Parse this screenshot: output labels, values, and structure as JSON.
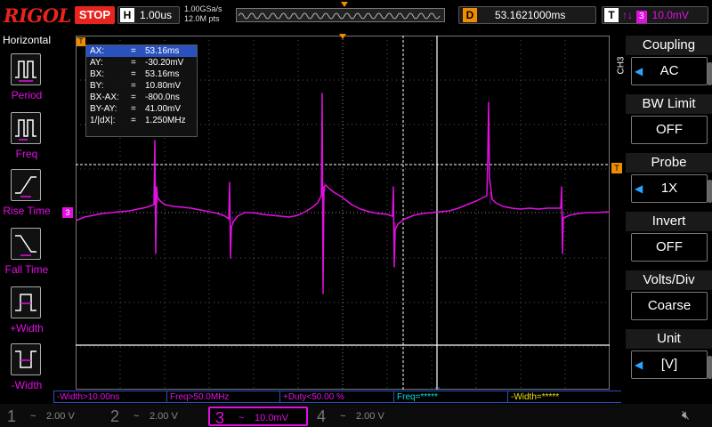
{
  "brand": "RIGOL",
  "run_state": "STOP",
  "timebase": {
    "label": "H",
    "value": "1.00us"
  },
  "acquisition": {
    "sample_rate": "1.00GSa/s",
    "points": "12.0M pts"
  },
  "delay": {
    "label": "D",
    "value": "53.1621000ms"
  },
  "trigger": {
    "label": "T",
    "edge": "↑↓",
    "source": "3",
    "level": "10.0mV"
  },
  "left_menu": {
    "title": "Horizontal",
    "items": [
      {
        "label": "Period",
        "icon": "period-icon"
      },
      {
        "label": "Freq",
        "icon": "freq-icon"
      },
      {
        "label": "Rise Time",
        "icon": "rise-time-icon"
      },
      {
        "label": "Fall Time",
        "icon": "fall-time-icon"
      },
      {
        "label": "+Width",
        "icon": "plus-width-icon"
      },
      {
        "label": "-Width",
        "icon": "minus-width-icon"
      }
    ]
  },
  "cursor_readout": [
    {
      "key": "AX:",
      "value": "53.16ms"
    },
    {
      "key": "AY:",
      "value": "-30.20mV"
    },
    {
      "key": "BX:",
      "value": "53.16ms"
    },
    {
      "key": "BY:",
      "value": "10.80mV"
    },
    {
      "key": "BX-AX:",
      "value": "-800.0ns"
    },
    {
      "key": "BY-AY:",
      "value": "41.00mV"
    },
    {
      "key": "1/|dX|:",
      "value": "1.250MHz"
    }
  ],
  "cursor_eq": "=",
  "right_menu": {
    "channel_tag": "CH3",
    "items": [
      {
        "title": "Coupling",
        "value": "AC",
        "has_arrow": true
      },
      {
        "title": "BW Limit",
        "value": "OFF",
        "has_arrow": false
      },
      {
        "title": "Probe",
        "value": "1X",
        "has_arrow": true
      },
      {
        "title": "Invert",
        "value": "OFF",
        "has_arrow": false
      },
      {
        "title": "Volts/Div",
        "value": "Coarse",
        "has_arrow": false
      },
      {
        "title": "Unit",
        "value": "[V]",
        "has_arrow": true
      }
    ]
  },
  "measurements": [
    {
      "text": "-Width>10.00ns",
      "channel": "ch3"
    },
    {
      "text": "Freq>50.0MHz",
      "channel": "ch3"
    },
    {
      "text": "+Duty<50.00 %",
      "channel": "ch3"
    },
    {
      "text": "Freq=*****",
      "channel": "ch2"
    },
    {
      "text": "-Width=*****",
      "channel": "ch1"
    }
  ],
  "channels": [
    {
      "num": "1",
      "coupling": "~",
      "scale": "2.00 V",
      "active": false
    },
    {
      "num": "2",
      "coupling": "~",
      "scale": "2.00 V",
      "active": false
    },
    {
      "num": "3",
      "coupling": "~",
      "scale": "10.0mV",
      "active": true
    },
    {
      "num": "4",
      "coupling": "~",
      "scale": "2.00 V",
      "active": false
    }
  ],
  "markers": {
    "ch3_ground": "3",
    "trigger_level": "T",
    "time_cursor": "T"
  },
  "colors": {
    "ch3": "#e010e0",
    "accent": "#f08c00",
    "brand": "#e8241d",
    "selection": "#2a52be"
  }
}
